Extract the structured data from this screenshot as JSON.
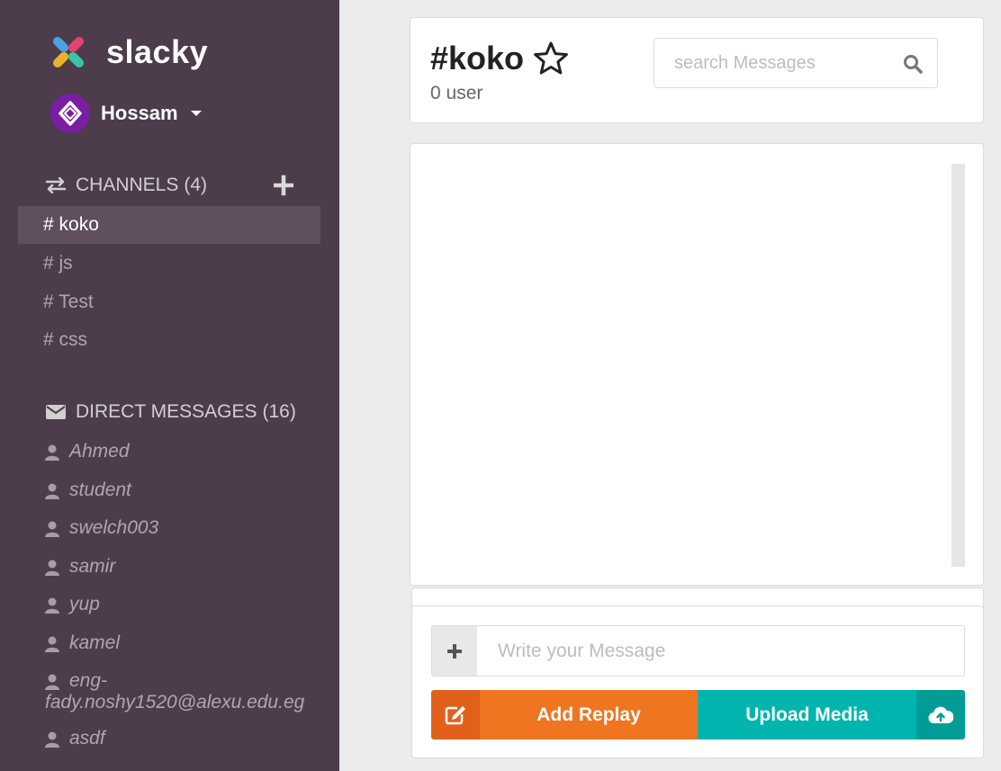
{
  "app": {
    "name": "slacky"
  },
  "user": {
    "name": "Hossam"
  },
  "channels": {
    "label": "CHANNELS",
    "count": "(4)",
    "items": [
      {
        "label": "# koko",
        "active": true
      },
      {
        "label": "# js"
      },
      {
        "label": "# Test"
      },
      {
        "label": "# css"
      }
    ]
  },
  "direct_messages": {
    "label": "DIRECT MESSAGES",
    "count": "(16)",
    "items": [
      {
        "label": "Ahmed"
      },
      {
        "label": "student"
      },
      {
        "label": "swelch003"
      },
      {
        "label": "samir"
      },
      {
        "label": "yup"
      },
      {
        "label": "kamel"
      },
      {
        "label_line1": "eng-",
        "label_line2": "fady.noshy1520@alexu.edu.eg"
      },
      {
        "label": "asdf"
      }
    ]
  },
  "header": {
    "title": "#koko",
    "user_count": "0 user",
    "search_placeholder": "search Messages"
  },
  "composer": {
    "placeholder": "Write your Message",
    "add_reply": "Add Replay",
    "upload_media": "Upload Media"
  },
  "colors": {
    "sidebar": "#4c3c4c",
    "orange": "#f07521",
    "teal": "#00b5ad"
  },
  "icons": [
    "slacky-logo-icon",
    "user-avatar-icon",
    "caret-down-icon",
    "exchange-icon",
    "plus-icon",
    "envelope-icon",
    "user-icon",
    "star-icon",
    "search-icon",
    "edit-icon",
    "cloud-upload-icon"
  ]
}
